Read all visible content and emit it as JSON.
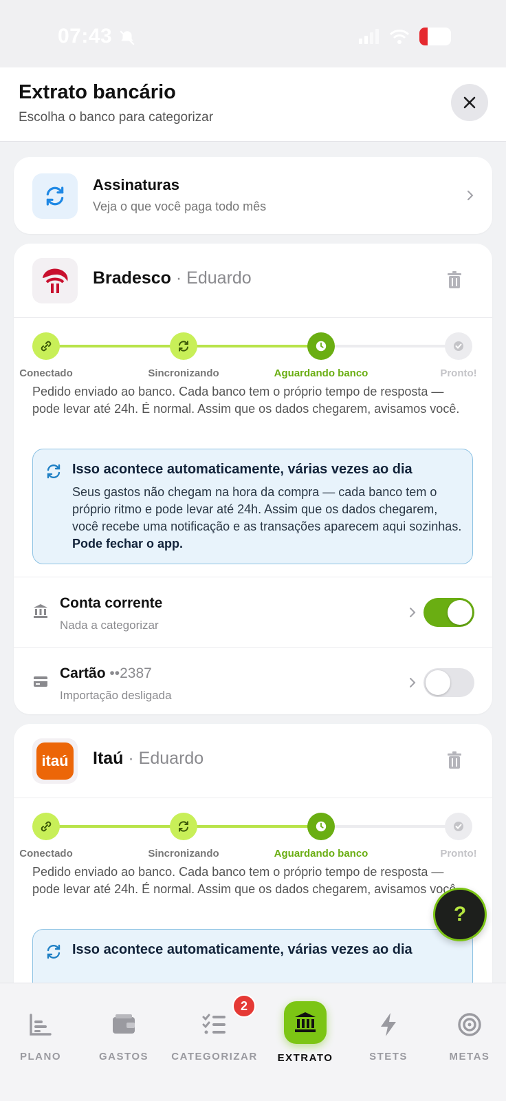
{
  "status_bar": {
    "time": "07:43",
    "battery": "16"
  },
  "header": {
    "title": "Extrato bancário",
    "subtitle": "Escolha o banco para categorizar"
  },
  "subscriptions": {
    "title": "Assinaturas",
    "description": "Veja o que você paga todo mês"
  },
  "steps": [
    "Conectado",
    "Sincronizando",
    "Aguardando banco",
    "Pronto!"
  ],
  "banks": [
    {
      "name": "Bradesco",
      "owner": "· Eduardo",
      "message": "Pedido enviado ao banco. Cada banco tem o próprio tempo de resposta — pode levar até 24h. É normal. Assim que os dados chegarem, avisamos você.",
      "info_title": "Isso acontece automaticamente, várias vezes ao dia",
      "info_body": "Seus gastos não chegam na hora da compra — cada banco tem o próprio ritmo e pode levar até 24h. Assim que os dados chegarem, você recebe uma notificação e as transações aparecem aqui sozinhas.",
      "info_bold": "Pode fechar o app.",
      "accounts": [
        {
          "title": "Conta corrente",
          "mask": "",
          "subtitle": "Nada a categorizar",
          "enabled": true
        },
        {
          "title": "Cartão",
          "mask": "••2387",
          "subtitle": "Importação desligada",
          "enabled": false
        }
      ]
    },
    {
      "name": "Itaú",
      "owner": "· Eduardo",
      "logo_text": "itaú",
      "message": "Pedido enviado ao banco. Cada banco tem o próprio tempo de resposta — pode levar até 24h. É normal. Assim que os dados chegarem, avisamos você.",
      "info_title": "Isso acontece automaticamente, várias vezes ao dia"
    }
  ],
  "help_button": "?",
  "nav": [
    {
      "label": "PLANO"
    },
    {
      "label": "GASTOS"
    },
    {
      "label": "CATEGORIZAR",
      "badge": "2"
    },
    {
      "label": "EXTRATO",
      "active": true
    },
    {
      "label": "STETS"
    },
    {
      "label": "METAS"
    }
  ],
  "colors": {
    "accent": "#7cc514",
    "info_border": "#8fc3e4",
    "info_bg": "#e8f3fb",
    "badge": "#e53935"
  }
}
